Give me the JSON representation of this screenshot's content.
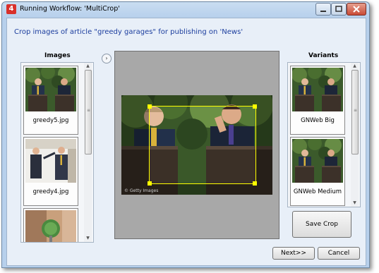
{
  "window": {
    "title": "Running Workflow: 'MultiCrop'",
    "app_icon_glyph": "4"
  },
  "headline": "Crop images of article \"greedy garages\" for publishing on 'News'",
  "images_panel": {
    "label": "Images",
    "items": [
      {
        "caption": "greedy5.jpg",
        "thumb": "two-men-at-podiums"
      },
      {
        "caption": "greedy4.jpg",
        "thumb": "men-greeting"
      },
      {
        "caption": "",
        "thumb": "microphone-closeup"
      }
    ]
  },
  "variants_panel": {
    "label": "Variants",
    "items": [
      {
        "caption": "GNWeb Big",
        "thumb": "two-men-at-podiums"
      },
      {
        "caption": "GNWeb Medium",
        "thumb": "two-men-at-podiums"
      }
    ]
  },
  "preview": {
    "watermark": "© Getty Images"
  },
  "buttons": {
    "save_crop": "Save Crop",
    "next": "Next>>",
    "cancel": "Cancel"
  },
  "icons": {
    "collapse": "chevron-right-icon",
    "minimize": "minimize-icon",
    "maximize": "maximize-icon",
    "close": "close-icon"
  },
  "colors": {
    "accent_text": "#1c3e9e",
    "crop_highlight": "#ffff00",
    "close_button": "#c94b36"
  }
}
